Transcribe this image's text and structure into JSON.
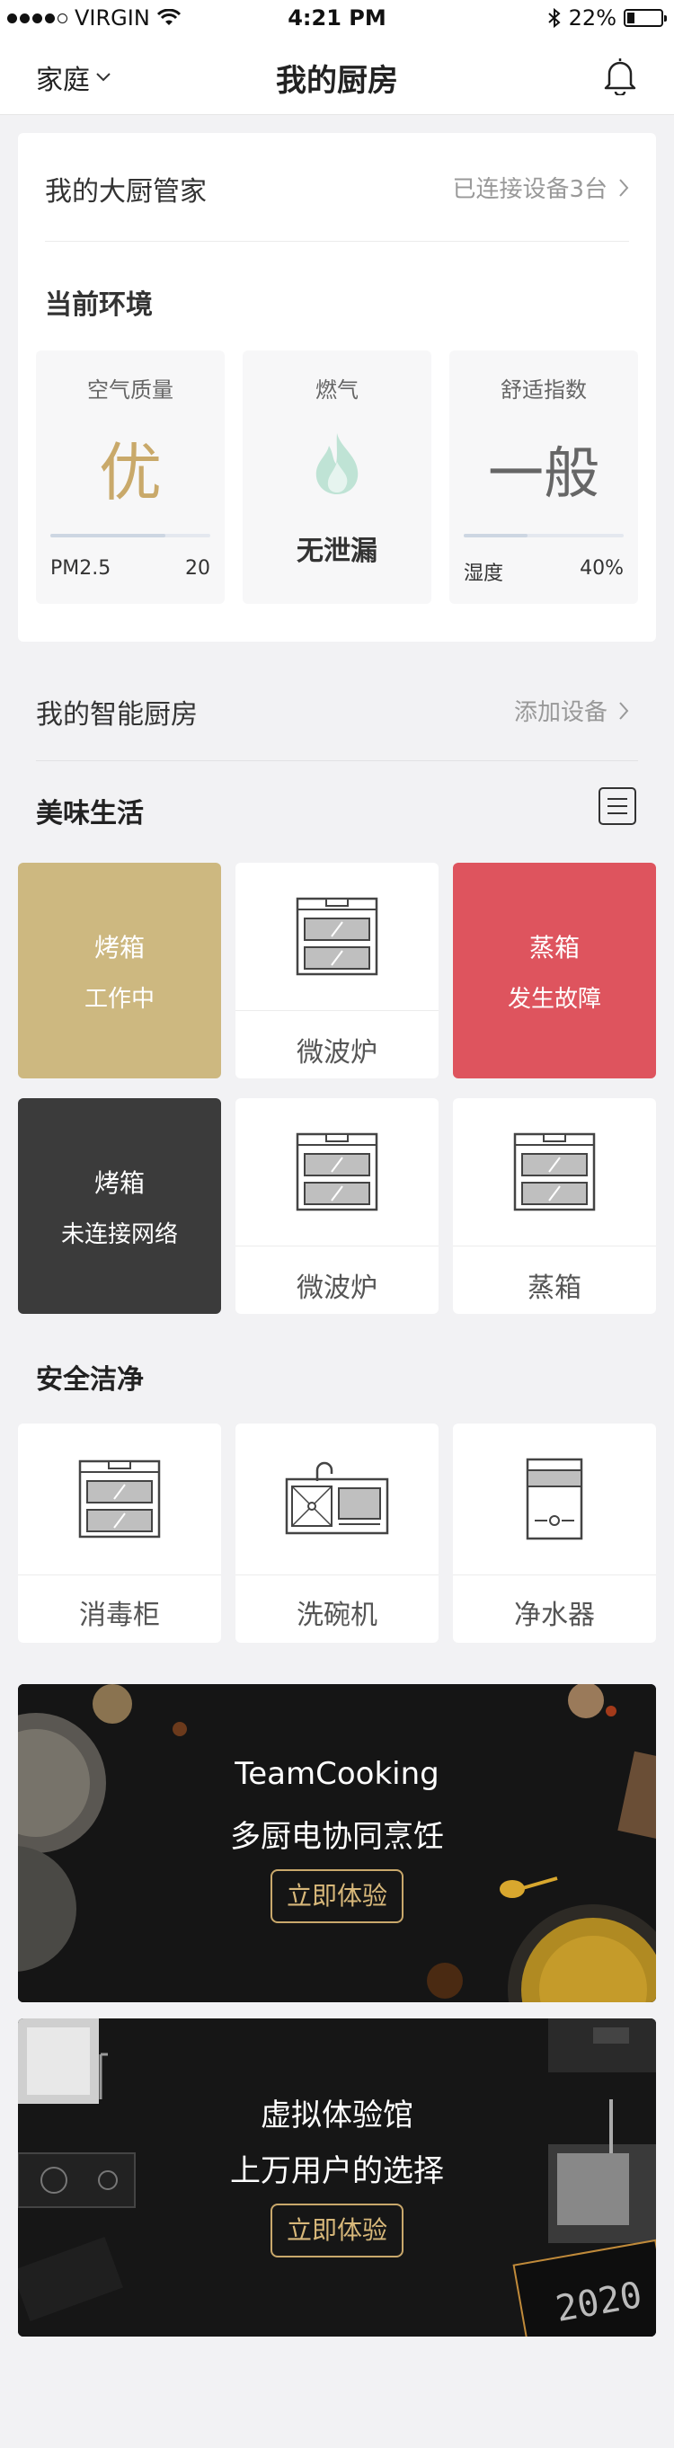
{
  "status_bar": {
    "carrier": "VIRGIN",
    "time": "4:21 PM",
    "battery": "22%",
    "battery_level": 0.22
  },
  "nav": {
    "family": "家庭",
    "title": "我的厨房"
  },
  "butler": {
    "title": "我的大厨管家",
    "connected": "已连接设备3台",
    "env_title": "当前环境",
    "air": {
      "label": "空气质量",
      "value": "优",
      "metric": "PM2.5",
      "metric_value": "20",
      "level": 0.72
    },
    "gas": {
      "label": "燃气",
      "status": "无泄漏"
    },
    "comfort": {
      "label": "舒适指数",
      "value": "一般",
      "metric": "湿度",
      "metric_value": "40%",
      "level": 0.4
    }
  },
  "smart_kitchen": {
    "title": "我的智能厨房",
    "add": "添加设备"
  },
  "sections": {
    "delicious": "美味生活",
    "safety": "安全洁净"
  },
  "devices": [
    {
      "name": "烤箱",
      "status": "工作中",
      "bg": "#cdb880"
    },
    {
      "label": "微波炉"
    },
    {
      "name": "蒸箱",
      "status": "发生故障",
      "bg": "#de545e"
    },
    {
      "name": "烤箱",
      "status": "未连接网络",
      "bg": "#3b3b3b"
    },
    {
      "label": "微波炉"
    },
    {
      "label": "蒸箱"
    }
  ],
  "safety_devices": [
    {
      "label": "消毒柜"
    },
    {
      "label": "洗碗机"
    },
    {
      "label": "净水器"
    }
  ],
  "banners": [
    {
      "line1": "TeamCooking",
      "line2": "多厨电协同烹饪",
      "button": "立即体验"
    },
    {
      "line1": "虚拟体验馆",
      "line2": "上万用户的选择",
      "button": "立即体验"
    }
  ],
  "colors": {
    "accent_gold": "#c9a86b",
    "air_good": "#c9a96a",
    "gas_icon": "#a9d9c7"
  }
}
